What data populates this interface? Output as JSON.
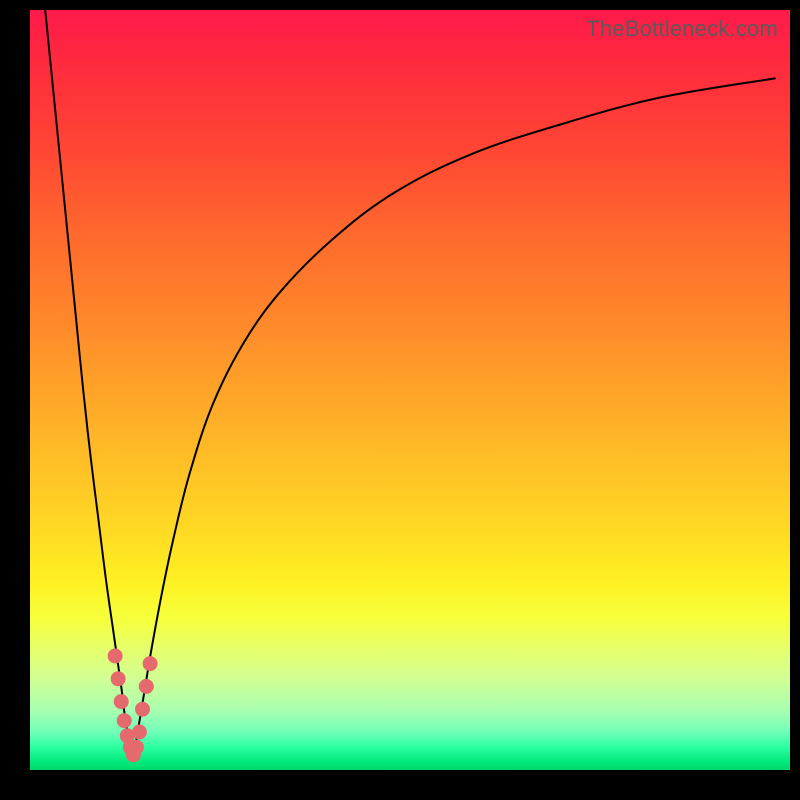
{
  "watermark": "TheBottleneck.com",
  "colors": {
    "frame_bg": "#000000",
    "curve_stroke": "#000000",
    "marker_fill": "#e46a6d",
    "gradient_top": "#ff1a4a",
    "gradient_bottom": "#00d868"
  },
  "chart_data": {
    "type": "line",
    "title": "",
    "xlabel": "",
    "ylabel": "",
    "xlim": [
      0,
      100
    ],
    "ylim": [
      0,
      100
    ],
    "grid": false,
    "legend": false,
    "series": [
      {
        "name": "bottleneck-curve-left",
        "x": [
          2,
          3,
          4,
          5,
          6,
          7,
          8,
          9,
          10,
          11,
          12,
          12.5,
          13,
          13.5
        ],
        "values": [
          100,
          90,
          80,
          70,
          60,
          50,
          41,
          33,
          25,
          18,
          11,
          7,
          4,
          1.5
        ]
      },
      {
        "name": "bottleneck-curve-right",
        "x": [
          13.5,
          14,
          15,
          16,
          17.5,
          19,
          21,
          24,
          28,
          33,
          40,
          48,
          58,
          70,
          83,
          98
        ],
        "values": [
          1.5,
          4,
          10,
          16,
          24,
          31,
          39,
          48,
          56,
          63,
          70,
          76,
          81,
          85,
          88.5,
          91
        ]
      }
    ],
    "markers": {
      "name": "highlight-cluster",
      "points": [
        {
          "x": 11.2,
          "y": 15
        },
        {
          "x": 11.6,
          "y": 12
        },
        {
          "x": 12.0,
          "y": 9
        },
        {
          "x": 12.4,
          "y": 6.5
        },
        {
          "x": 12.8,
          "y": 4.5
        },
        {
          "x": 13.2,
          "y": 3
        },
        {
          "x": 13.6,
          "y": 2
        },
        {
          "x": 14.0,
          "y": 3
        },
        {
          "x": 14.4,
          "y": 5
        },
        {
          "x": 14.8,
          "y": 8
        },
        {
          "x": 15.3,
          "y": 11
        },
        {
          "x": 15.8,
          "y": 14
        }
      ],
      "radius": 7
    }
  }
}
